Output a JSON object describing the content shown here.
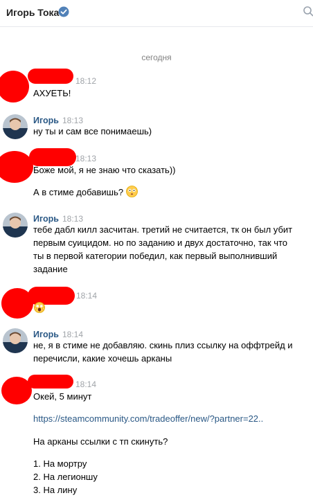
{
  "header": {
    "title": "Игорь Токач"
  },
  "date_separator": "сегодня",
  "messages": [
    {
      "name": "",
      "time": "18:12",
      "lines": [
        "АХУЕТЬ!"
      ]
    },
    {
      "name": "Игорь",
      "time": "18:13",
      "lines": [
        "ну ты и сам все понимаешь)"
      ]
    },
    {
      "name": "",
      "time": "18:13",
      "lines": [
        "Боже мой, я не знаю что сказать))",
        "А в стиме добавишь?"
      ]
    },
    {
      "name": "Игорь",
      "time": "18:13",
      "lines": [
        "тебе дабл килл засчитан. третий не считается, тк он был убит",
        "первым суицидом. но по заданию и двух достаточно, так что",
        "ты в первой категории победил, как первый выполнивший",
        "задание"
      ]
    },
    {
      "name": "",
      "time": "18:14",
      "lines": []
    },
    {
      "name": "Игорь",
      "time": "18:14",
      "lines": [
        "не, я в стиме не добавляю. скинь плиз ссылку на оффтрейд и",
        "перечисли, какие хочешь арканы"
      ]
    },
    {
      "name": "",
      "time": "18:14",
      "lines": [
        "Окей, 5 минут",
        "https://steamcommunity.com/tradeoffer/new/?partner=22..",
        "На арканы ссылки с тп скинуть?",
        "1. На мортру",
        "2. На легионшу",
        "3. На лину"
      ]
    }
  ],
  "colors": {
    "link": "#2a5885",
    "time": "#a0a4a9",
    "redaction": "#ff0000",
    "verified": "#5181b8"
  }
}
